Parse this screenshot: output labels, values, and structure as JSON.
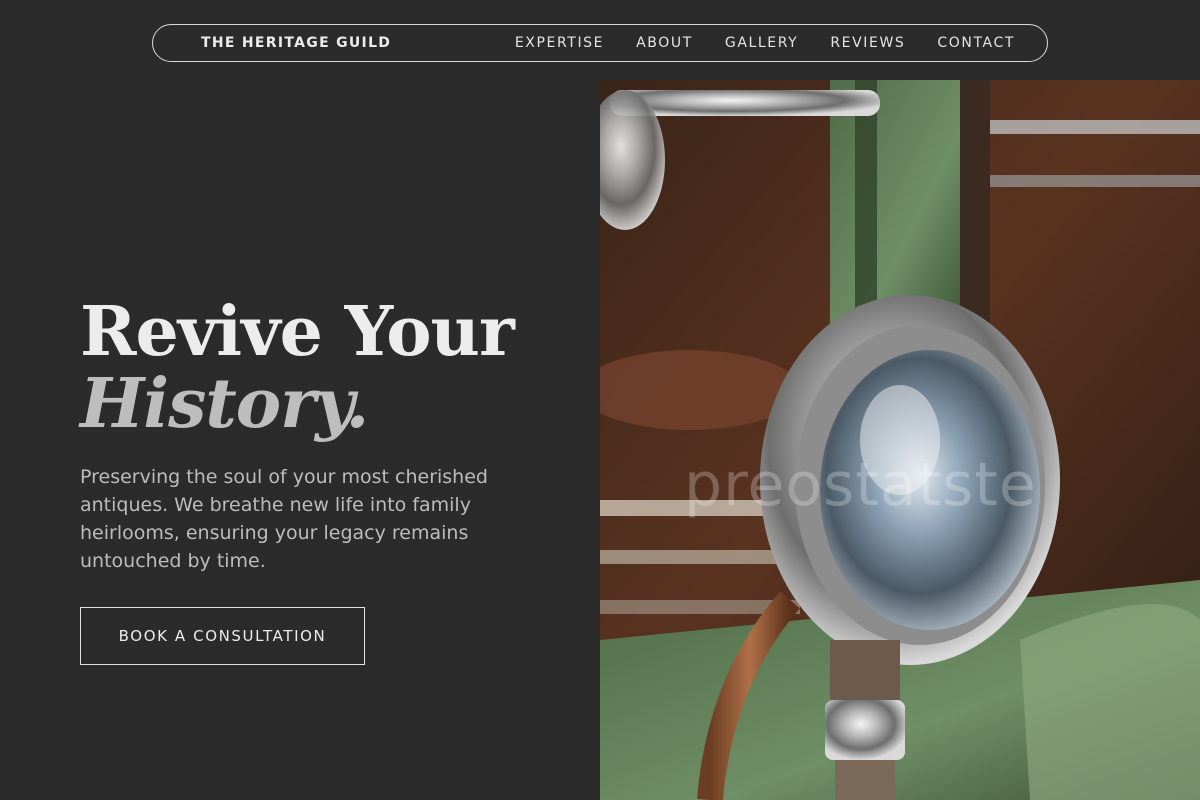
{
  "nav": {
    "brand": "THE HERITAGE GUILD",
    "links": [
      {
        "label": "EXPERTISE"
      },
      {
        "label": "ABOUT"
      },
      {
        "label": "GALLERY"
      },
      {
        "label": "REVIEWS"
      },
      {
        "label": "CONTACT"
      }
    ]
  },
  "hero": {
    "title_line1": "Revive Your",
    "title_line2": "History.",
    "description": "Preserving the soul of your most cherished antiques. We breathe new life into family heirlooms, ensuring your legacy remains untouched by time.",
    "cta_label": "BOOK A CONSULTATION",
    "image_watermark": "preostatste"
  },
  "colors": {
    "background": "#2b2b2b",
    "text_primary": "#ececec",
    "text_secondary": "#bcbcbc",
    "border": "#d9d9d9"
  }
}
